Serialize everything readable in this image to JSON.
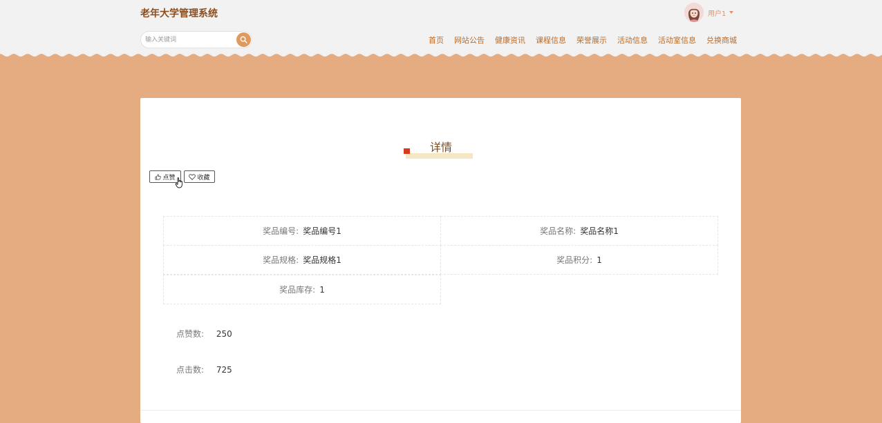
{
  "header": {
    "site_title": "老年大学管理系统",
    "search_placeholder": "输入关键词",
    "user_name": "用户1"
  },
  "nav": [
    "首页",
    "网站公告",
    "健康资讯",
    "课程信息",
    "荣誉展示",
    "活动信息",
    "活动室信息",
    "兑换商城"
  ],
  "detail": {
    "title": "详情",
    "like_label": "点赞",
    "favorite_label": "收藏",
    "fields": [
      {
        "label": "奖品编号:",
        "value": "奖品编号1"
      },
      {
        "label": "奖品名称:",
        "value": "奖品名称1"
      },
      {
        "label": "奖品规格:",
        "value": "奖品规格1"
      },
      {
        "label": "奖品积分:",
        "value": "1"
      },
      {
        "label": "奖品库存:",
        "value": "1"
      }
    ],
    "stats": [
      {
        "label": "点赞数:",
        "value": "250"
      },
      {
        "label": "点击数:",
        "value": "725"
      }
    ]
  },
  "colors": {
    "background": "#e5ac82",
    "header": "#f2f2f2",
    "accent": "#e09a5d",
    "nav_text": "#b86b2c",
    "title_text": "#8a4d1f"
  },
  "icons": {
    "search": "search-icon",
    "like": "thumbs-up-icon",
    "favorite": "heart-icon",
    "avatar": "avatar",
    "caret": "caret-down-icon"
  }
}
